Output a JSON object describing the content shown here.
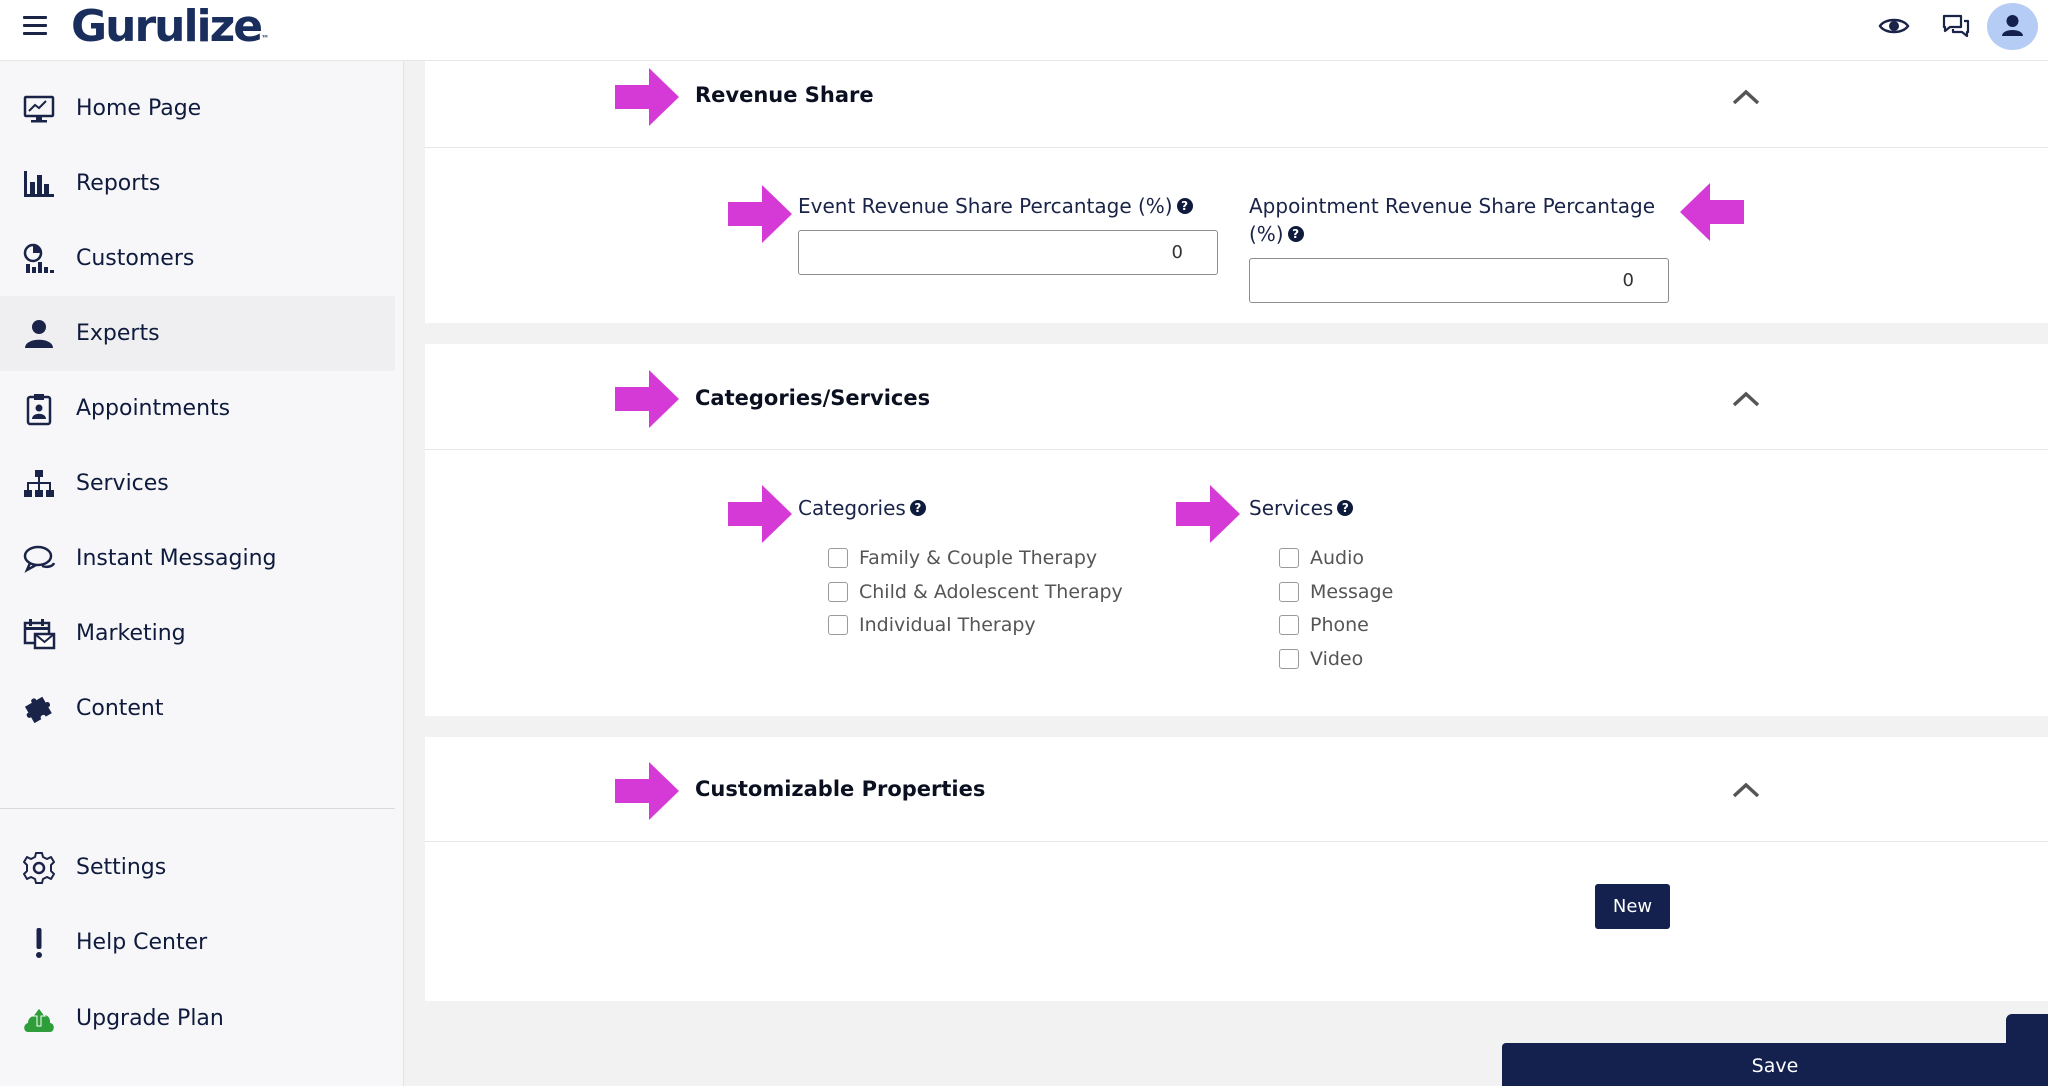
{
  "header": {
    "logo_text": "Gurulize",
    "logo_mark": "™",
    "icons": [
      "eye-icon",
      "chat-icon",
      "user-avatar-icon"
    ]
  },
  "sidebar": {
    "items": [
      {
        "label": "Home Page",
        "icon": "monitor-icon"
      },
      {
        "label": "Reports",
        "icon": "bar-chart-icon"
      },
      {
        "label": "Customers",
        "icon": "customers-icon"
      },
      {
        "label": "Experts",
        "icon": "expert-icon"
      },
      {
        "label": "Appointments",
        "icon": "clipboard-icon"
      },
      {
        "label": "Services",
        "icon": "hierarchy-icon"
      },
      {
        "label": "Instant Messaging",
        "icon": "messaging-icon"
      },
      {
        "label": "Marketing",
        "icon": "calendar-mail-icon"
      },
      {
        "label": "Content",
        "icon": "puzzle-icon"
      }
    ],
    "bottom_items": [
      {
        "label": "Settings",
        "icon": "gear-icon"
      },
      {
        "label": "Help Center",
        "icon": "exclamation-icon"
      },
      {
        "label": "Upgrade Plan",
        "icon": "upload-cloud-icon"
      }
    ],
    "active": "Experts"
  },
  "revenue_share": {
    "title": "Revenue Share",
    "event_label": "Event Revenue Share Percantage (%)",
    "event_value": "0",
    "appointment_label_line1": "Appointment Revenue Share Percantage",
    "appointment_label_line2": "(%)",
    "appointment_value": "0",
    "help_glyph": "?"
  },
  "categories_services": {
    "title": "Categories/Services",
    "categories_label": "Categories",
    "categories": [
      "Family & Couple Therapy",
      "Child & Adolescent Therapy",
      "Individual Therapy"
    ],
    "services_label": "Services",
    "services": [
      "Audio",
      "Message",
      "Phone",
      "Video"
    ]
  },
  "custom_properties": {
    "title": "Customizable Properties",
    "new_button": "New"
  },
  "footer": {
    "save_button": "Save"
  },
  "colors": {
    "navy": "#14204d",
    "arrow_magenta": "#d63ad6",
    "avatar_bg": "#b5cdf4"
  }
}
